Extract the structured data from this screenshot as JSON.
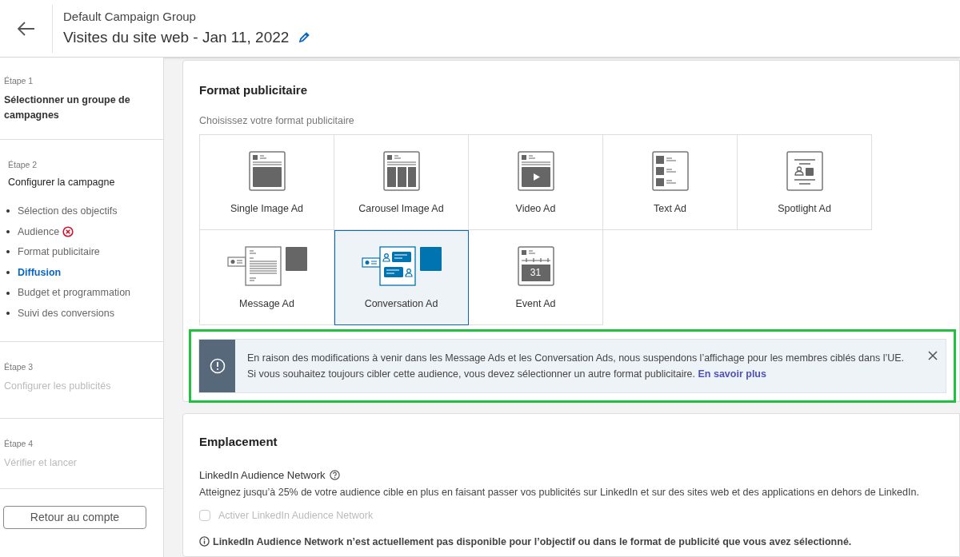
{
  "header": {
    "group": "Default Campaign Group",
    "title": "Visites du site web - Jan 11, 2022"
  },
  "steps": [
    {
      "step": "Étape 1",
      "title": "Sélectionner un groupe de campagnes",
      "disabled": false
    },
    {
      "step": "Étape 2",
      "title": "Configurer la campagne",
      "disabled": false,
      "items": [
        {
          "label": "Sélection des objectifs",
          "selected": false,
          "error": false
        },
        {
          "label": "Audience",
          "selected": false,
          "error": true
        },
        {
          "label": "Format publicitaire",
          "selected": false,
          "error": false
        },
        {
          "label": "Diffusion",
          "selected": true,
          "error": false
        },
        {
          "label": "Budget et programmation",
          "selected": false,
          "error": false
        },
        {
          "label": "Suivi des conversions",
          "selected": false,
          "error": false
        }
      ]
    },
    {
      "step": "Étape 3",
      "title": "Configurer les publicités",
      "disabled": true
    },
    {
      "step": "Étape 4",
      "title": "Vérifier et lancer",
      "disabled": true
    }
  ],
  "back_button": "Retour au compte",
  "format": {
    "title": "Format publicitaire",
    "subtitle": "Choisissez votre format publicitaire",
    "tiles": [
      {
        "kind": "single",
        "label": "Single Image Ad",
        "selected": false
      },
      {
        "kind": "carousel",
        "label": "Carousel Image Ad",
        "selected": false
      },
      {
        "kind": "video",
        "label": "Video Ad",
        "selected": false
      },
      {
        "kind": "text",
        "label": "Text Ad",
        "selected": false
      },
      {
        "kind": "spotlight",
        "label": "Spotlight Ad",
        "selected": false
      },
      {
        "kind": "message",
        "label": "Message Ad",
        "selected": false
      },
      {
        "kind": "conversation",
        "label": "Conversation Ad",
        "selected": true
      },
      {
        "kind": "event",
        "label": "Event Ad",
        "selected": false,
        "day": "31"
      }
    ],
    "alert": {
      "text": "En raison des modifications à venir dans les Message Ads et les Conversation Ads, nous suspendons l’affichage pour les membres ciblés dans l’UE. Si vous souhaitez toujours cibler cette audience, vous devez sélectionner un autre format publicitaire.",
      "link": "En savoir plus",
      "highlighted": true
    }
  },
  "placement": {
    "title": "Emplacement",
    "network_label": "LinkedIn Audience Network",
    "description": "Atteignez jusqu’à 25% de votre audience cible en plus en faisant passer vos publicités sur LinkedIn et sur des sites web et des applications en dehors de LinkedIn.",
    "checkbox": {
      "label": "Activer LinkedIn Audience Network",
      "checked": false,
      "disabled": true
    },
    "note": "LinkedIn Audience Network n’est actuellement pas disponible pour l’objectif ou dans le format de publicité que vous avez sélectionné."
  }
}
